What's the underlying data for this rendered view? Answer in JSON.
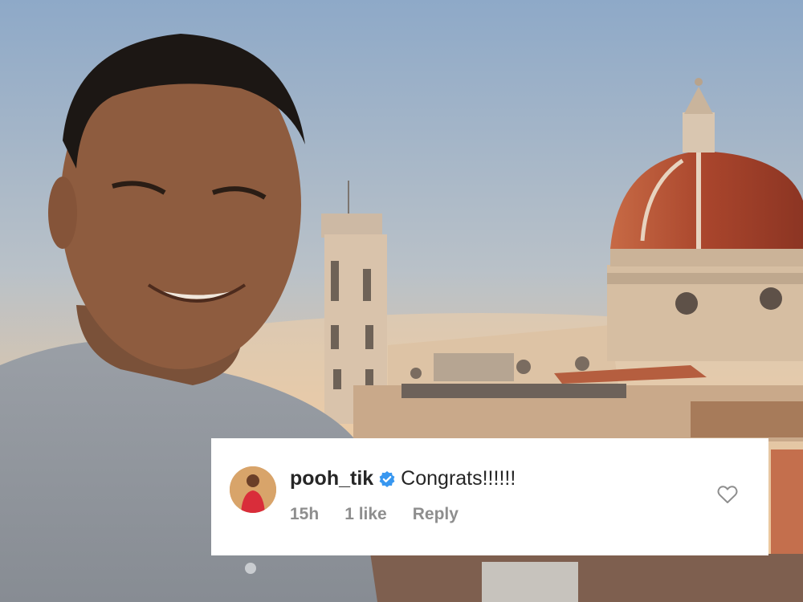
{
  "comment": {
    "username": "pooh_tik",
    "text": "Congrats!!!!!!",
    "time": "15h",
    "likes": "1 like",
    "reply_label": "Reply"
  },
  "icons": {
    "verified": "verified-badge-icon",
    "like": "heart-outline-icon"
  },
  "colors": {
    "verified_blue": "#3897f0",
    "text": "#262626",
    "meta": "#8e8e8e",
    "card": "#ffffff"
  }
}
